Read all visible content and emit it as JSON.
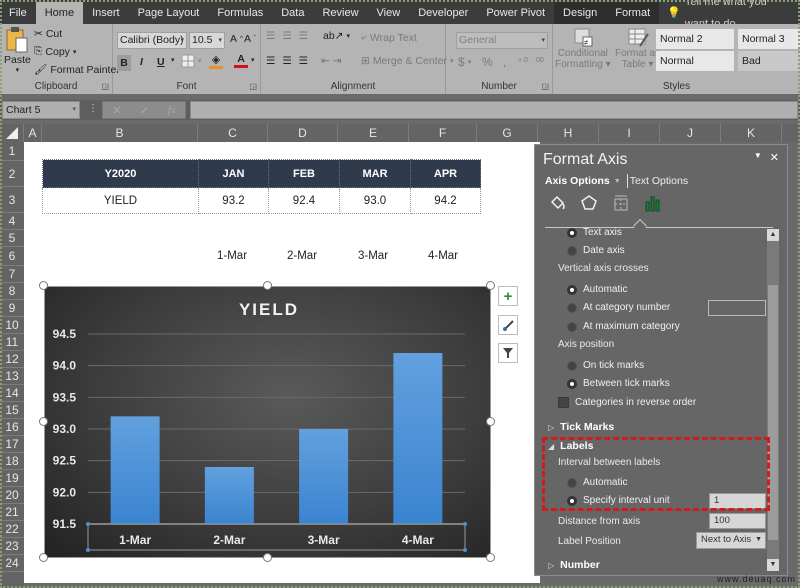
{
  "ribbon": {
    "tabs": [
      "File",
      "Home",
      "Insert",
      "Page Layout",
      "Formulas",
      "Data",
      "Review",
      "View",
      "Developer",
      "Power Pivot",
      "Design",
      "Format"
    ],
    "active_tab": "Home",
    "tell_me": "Tell me what you want to do...",
    "clipboard": {
      "paste": "Paste",
      "cut": "Cut",
      "copy": "Copy",
      "format_painter": "Format Painter",
      "label": "Clipboard"
    },
    "font": {
      "family": "Calibri (Body)",
      "size": "10.5",
      "grow": "A",
      "shrink": "A",
      "bold": "B",
      "italic": "I",
      "underline": "U",
      "font_color": "A",
      "label": "Font"
    },
    "alignment": {
      "wrap_text": "Wrap Text",
      "merge_center": "Merge & Center",
      "label": "Alignment"
    },
    "number": {
      "format": "General",
      "currency": "$",
      "percent": "%",
      "comma": ",",
      "inc_decimal": "+.0 .00",
      "dec_decimal": ".00 +.0",
      "label": "Number"
    },
    "styles": {
      "conditional": "Conditional",
      "conditional2": "Formatting",
      "format_as": "Format as",
      "table": "Table",
      "cells": [
        "Normal 2",
        "Normal 3",
        "Normal",
        "Bad"
      ],
      "label": "Styles"
    }
  },
  "formula_bar": {
    "name_box": "Chart 5",
    "fx": "fx",
    "cancel": "✕",
    "enter": "✓",
    "value": ""
  },
  "columns": [
    "A",
    "B",
    "C",
    "D",
    "E",
    "F",
    "G",
    "H",
    "I",
    "J",
    "K"
  ],
  "rows": [
    "1",
    "2",
    "3",
    "4",
    "5",
    "6",
    "7",
    "8",
    "9",
    "10",
    "11",
    "12",
    "13",
    "14",
    "15",
    "16",
    "17",
    "18",
    "19",
    "20",
    "21",
    "22",
    "23",
    "24"
  ],
  "table": {
    "headers": [
      "Y2020",
      "JAN",
      "FEB",
      "MAR",
      "APR"
    ],
    "row": [
      "YIELD",
      "93.2",
      "92.4",
      "93.0",
      "94.2"
    ]
  },
  "row6_dates": [
    "1-Mar",
    "2-Mar",
    "3-Mar",
    "4-Mar"
  ],
  "chart_side_buttons": {
    "elements": "+",
    "styles": "brush",
    "filter": "filter"
  },
  "chart_data": {
    "type": "bar",
    "title": "YIELD",
    "categories": [
      "1-Mar",
      "2-Mar",
      "3-Mar",
      "4-Mar"
    ],
    "values": [
      93.2,
      92.4,
      93.0,
      94.2
    ],
    "ylim": [
      91.5,
      94.5
    ],
    "yticks": [
      "94.5",
      "94.0",
      "93.5",
      "93.0",
      "92.5",
      "92.0",
      "91.5"
    ],
    "xlabel": "",
    "ylabel": "",
    "grid": true,
    "bar_color": "#4a8fd6"
  },
  "pane": {
    "title": "Format Axis",
    "tab_axis": "Axis Options",
    "tab_text": "Text Options",
    "axis_type": {
      "text_axis": "Text axis",
      "date_axis": "Date axis",
      "selected": "Text axis"
    },
    "vertical_crosses_label": "Vertical axis crosses",
    "crosses": {
      "automatic": "Automatic",
      "at_category": "At category number",
      "at_max": "At maximum category",
      "selected": "Automatic",
      "category_value": ""
    },
    "axis_position_label": "Axis position",
    "position": {
      "on_tick": "On tick marks",
      "between": "Between tick marks",
      "selected": "Between tick marks"
    },
    "reverse_order": "Categories in reverse order",
    "reverse_checked": false,
    "tick_marks": "Tick Marks",
    "labels": "Labels",
    "interval_label": "Interval between labels",
    "interval": {
      "automatic": "Automatic",
      "specify": "Specify interval unit",
      "selected": "Specify interval unit",
      "value": "1"
    },
    "distance_label": "Distance from axis",
    "distance_value": "100",
    "label_position_label": "Label Position",
    "label_position_value": "Next to Axis",
    "number": "Number"
  },
  "watermark": "www.deuaq.com"
}
